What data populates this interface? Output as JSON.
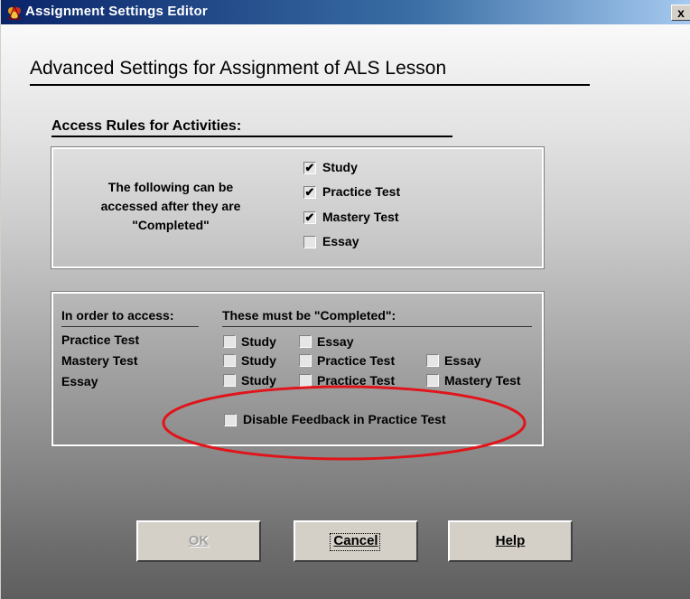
{
  "window": {
    "title": "Assignment Settings Editor",
    "close_label": "x",
    "icon": "app-logo-icon"
  },
  "heading": "Advanced Settings for Assignment of ALS Lesson",
  "access_rules": {
    "title": "Access Rules for Activities:",
    "description": "The following can be accessed after they are \"Completed\"",
    "description_lines": [
      "The following can be",
      "accessed after they are",
      "\"Completed\""
    ],
    "options": [
      {
        "label": "Study",
        "checked": true
      },
      {
        "label": "Practice Test",
        "checked": true
      },
      {
        "label": "Mastery Test",
        "checked": true
      },
      {
        "label": "Essay",
        "checked": false
      }
    ]
  },
  "prerequisites": {
    "left_header": "In order to access:",
    "right_header": "These must be \"Completed\":",
    "rows": [
      {
        "target": "Practice Test",
        "required": [
          {
            "label": "Study",
            "checked": false
          },
          {
            "label": "Essay",
            "checked": false
          }
        ]
      },
      {
        "target": "Mastery Test",
        "required": [
          {
            "label": "Study",
            "checked": false
          },
          {
            "label": "Practice Test",
            "checked": false
          },
          {
            "label": "Essay",
            "checked": false
          }
        ]
      },
      {
        "target": "Essay",
        "required": [
          {
            "label": "Study",
            "checked": false
          },
          {
            "label": "Practice Test",
            "checked": false
          },
          {
            "label": "Mastery Test",
            "checked": false
          }
        ]
      }
    ],
    "disable_feedback": {
      "label": "Disable Feedback in Practice Test",
      "checked": false
    }
  },
  "buttons": {
    "ok": {
      "label": "OK",
      "enabled": false
    },
    "cancel": {
      "label": "Cancel",
      "enabled": true,
      "focused": true
    },
    "help": {
      "label": "Help",
      "enabled": true
    }
  },
  "colors": {
    "titlebar_start": "#0a246a",
    "titlebar_end": "#a6caf0",
    "highlight_ellipse": "#e0141a",
    "button_face": "#d4d0c8"
  }
}
